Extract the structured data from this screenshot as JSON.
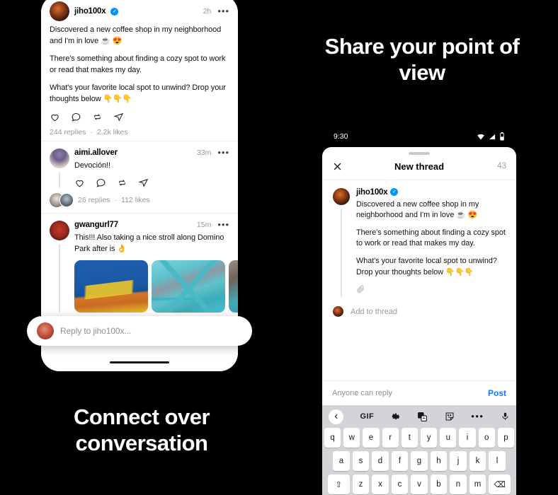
{
  "headlines": {
    "left": "Connect over conversation",
    "right": "Share your point of view"
  },
  "feed": {
    "main_post": {
      "username": "jiho100x",
      "verified_badge": "✓",
      "timestamp": "2h",
      "more_icon": "•••",
      "paragraphs": [
        "Discovered a new coffee shop in my neighborhood and I'm in love ☕ 😍",
        "There's something about finding a cozy spot to work or read that makes my day.",
        "What's your favorite local spot to unwind? Drop your thoughts below 👇👇👇"
      ],
      "actions": [
        "like-icon",
        "reply-icon",
        "repost-icon",
        "share-icon"
      ],
      "replies_count": "244 replies",
      "separator": "·",
      "likes_count": "2.2k likes"
    },
    "replies": [
      {
        "username": "aimi.allover",
        "timestamp": "33m",
        "more_icon": "•••",
        "text": "Devoción!!",
        "actions": [
          "like-icon",
          "reply-icon",
          "repost-icon",
          "share-icon"
        ],
        "replies_count": "26 replies",
        "separator": "·",
        "likes_count": "112 likes"
      },
      {
        "username": "gwangurl77",
        "timestamp": "15m",
        "more_icon": "•••",
        "text": "This!!! Also taking a nice stroll along Domino Park after is 👌",
        "thumbnails": [
          "domino-sugar-sign-photo",
          "teal-bridge-photo",
          "waterfront-photo"
        ]
      }
    ],
    "reply_bar": {
      "placeholder": "Reply to jiho100x...",
      "avatar": "user-avatar"
    }
  },
  "composer": {
    "status_bar": {
      "time": "9:30",
      "icons": [
        "wifi-icon",
        "cellular-signal-icon",
        "battery-icon"
      ]
    },
    "header": {
      "close_icon": "close-icon",
      "title": "New thread",
      "char_count": "43"
    },
    "post": {
      "username": "jiho100x",
      "verified_badge": "✓",
      "paragraphs": [
        "Discovered a new coffee shop in my neighborhood and I'm in love ☕ 😍",
        "There's something about finding a cozy spot to work or read that makes my day.",
        "What's your favorite local spot to unwind?Drop your thoughts below 👇👇👇"
      ],
      "attach_icon": "paperclip-icon"
    },
    "add_to_thread": {
      "label": "Add to thread",
      "avatar": "user-avatar"
    },
    "footer": {
      "audience_label": "Anyone can reply",
      "post_label": "Post",
      "post_color": "#1877f2"
    },
    "keyboard": {
      "toolbar": [
        "back-chevron-icon",
        "GIF",
        "gear-icon",
        "translate-icon",
        "sticker-icon",
        "more-dots-icon",
        "microphone-icon"
      ],
      "gif_label": "GIF",
      "row1": [
        "q",
        "w",
        "e",
        "r",
        "t",
        "y",
        "u",
        "i",
        "o",
        "p"
      ],
      "row2": [
        "a",
        "s",
        "d",
        "f",
        "g",
        "h",
        "j",
        "k",
        "l"
      ],
      "row3": [
        "⇧",
        "z",
        "x",
        "c",
        "v",
        "b",
        "n",
        "m",
        "⌫"
      ]
    }
  }
}
